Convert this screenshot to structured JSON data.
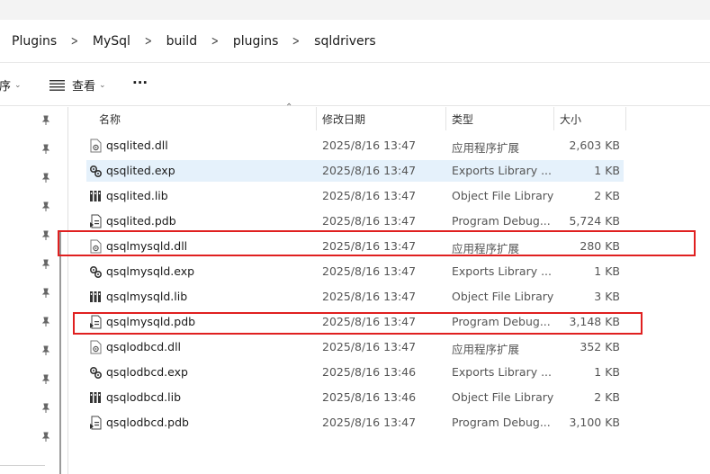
{
  "breadcrumb": [
    "Plugins",
    "MySql",
    "build",
    "plugins",
    "sqldrivers"
  ],
  "toolbar": {
    "sort_label": "排序",
    "view_label": "查看",
    "more_label": "···"
  },
  "columns": {
    "name": "名称",
    "date": "修改日期",
    "type": "类型",
    "size": "大小"
  },
  "files": [
    {
      "name": "qsqlited.dll",
      "date": "2025/8/16 13:47",
      "type": "应用程序扩展",
      "size": "2,603 KB",
      "icon": "dll-icon"
    },
    {
      "name": "qsqlited.exp",
      "date": "2025/8/16 13:47",
      "type": "Exports Library ...",
      "size": "1 KB",
      "icon": "exp-icon"
    },
    {
      "name": "qsqlited.lib",
      "date": "2025/8/16 13:47",
      "type": "Object File Library",
      "size": "2 KB",
      "icon": "lib-icon"
    },
    {
      "name": "qsqlited.pdb",
      "date": "2025/8/16 13:47",
      "type": "Program Debug...",
      "size": "5,724 KB",
      "icon": "pdb-icon"
    },
    {
      "name": "qsqlmysqld.dll",
      "date": "2025/8/16 13:47",
      "type": "应用程序扩展",
      "size": "280 KB",
      "icon": "dll-icon"
    },
    {
      "name": "qsqlmysqld.exp",
      "date": "2025/8/16 13:47",
      "type": "Exports Library ...",
      "size": "1 KB",
      "icon": "exp-icon"
    },
    {
      "name": "qsqlmysqld.lib",
      "date": "2025/8/16 13:47",
      "type": "Object File Library",
      "size": "3 KB",
      "icon": "lib-icon"
    },
    {
      "name": "qsqlmysqld.pdb",
      "date": "2025/8/16 13:47",
      "type": "Program Debug...",
      "size": "3,148 KB",
      "icon": "pdb-icon"
    },
    {
      "name": "qsqlodbcd.dll",
      "date": "2025/8/16 13:47",
      "type": "应用程序扩展",
      "size": "352 KB",
      "icon": "dll-icon"
    },
    {
      "name": "qsqlodbcd.exp",
      "date": "2025/8/16 13:46",
      "type": "Exports Library ...",
      "size": "1 KB",
      "icon": "exp-icon"
    },
    {
      "name": "qsqlodbcd.lib",
      "date": "2025/8/16 13:46",
      "type": "Object File Library",
      "size": "2 KB",
      "icon": "lib-icon"
    },
    {
      "name": "qsqlodbcd.pdb",
      "date": "2025/8/16 13:47",
      "type": "Program Debug...",
      "size": "3,100 KB",
      "icon": "pdb-icon"
    }
  ],
  "selected_index": 1,
  "highlight_color": "#e02020",
  "selection_color": "#e5f1fb"
}
